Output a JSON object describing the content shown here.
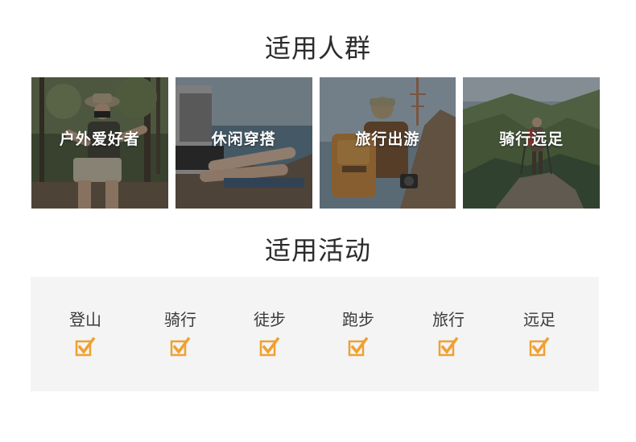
{
  "sections": {
    "people_title": "适用人群",
    "activities_title": "适用活动"
  },
  "people": [
    {
      "label": "户外爱好者",
      "icon": "hiker-photo"
    },
    {
      "label": "休闲穿搭",
      "icon": "casual-photo"
    },
    {
      "label": "旅行出游",
      "icon": "traveler-photo"
    },
    {
      "label": "骑行远足",
      "icon": "mountain-photo"
    }
  ],
  "activities": [
    {
      "label": "登山",
      "checked": true
    },
    {
      "label": "骑行",
      "checked": true
    },
    {
      "label": "徒步",
      "checked": true
    },
    {
      "label": "跑步",
      "checked": true
    },
    {
      "label": "旅行",
      "checked": true
    },
    {
      "label": "远足",
      "checked": true
    }
  ],
  "colors": {
    "accent": "#f0a030",
    "panel_bg": "#f4f4f4",
    "title_text": "#2b2b2b"
  }
}
